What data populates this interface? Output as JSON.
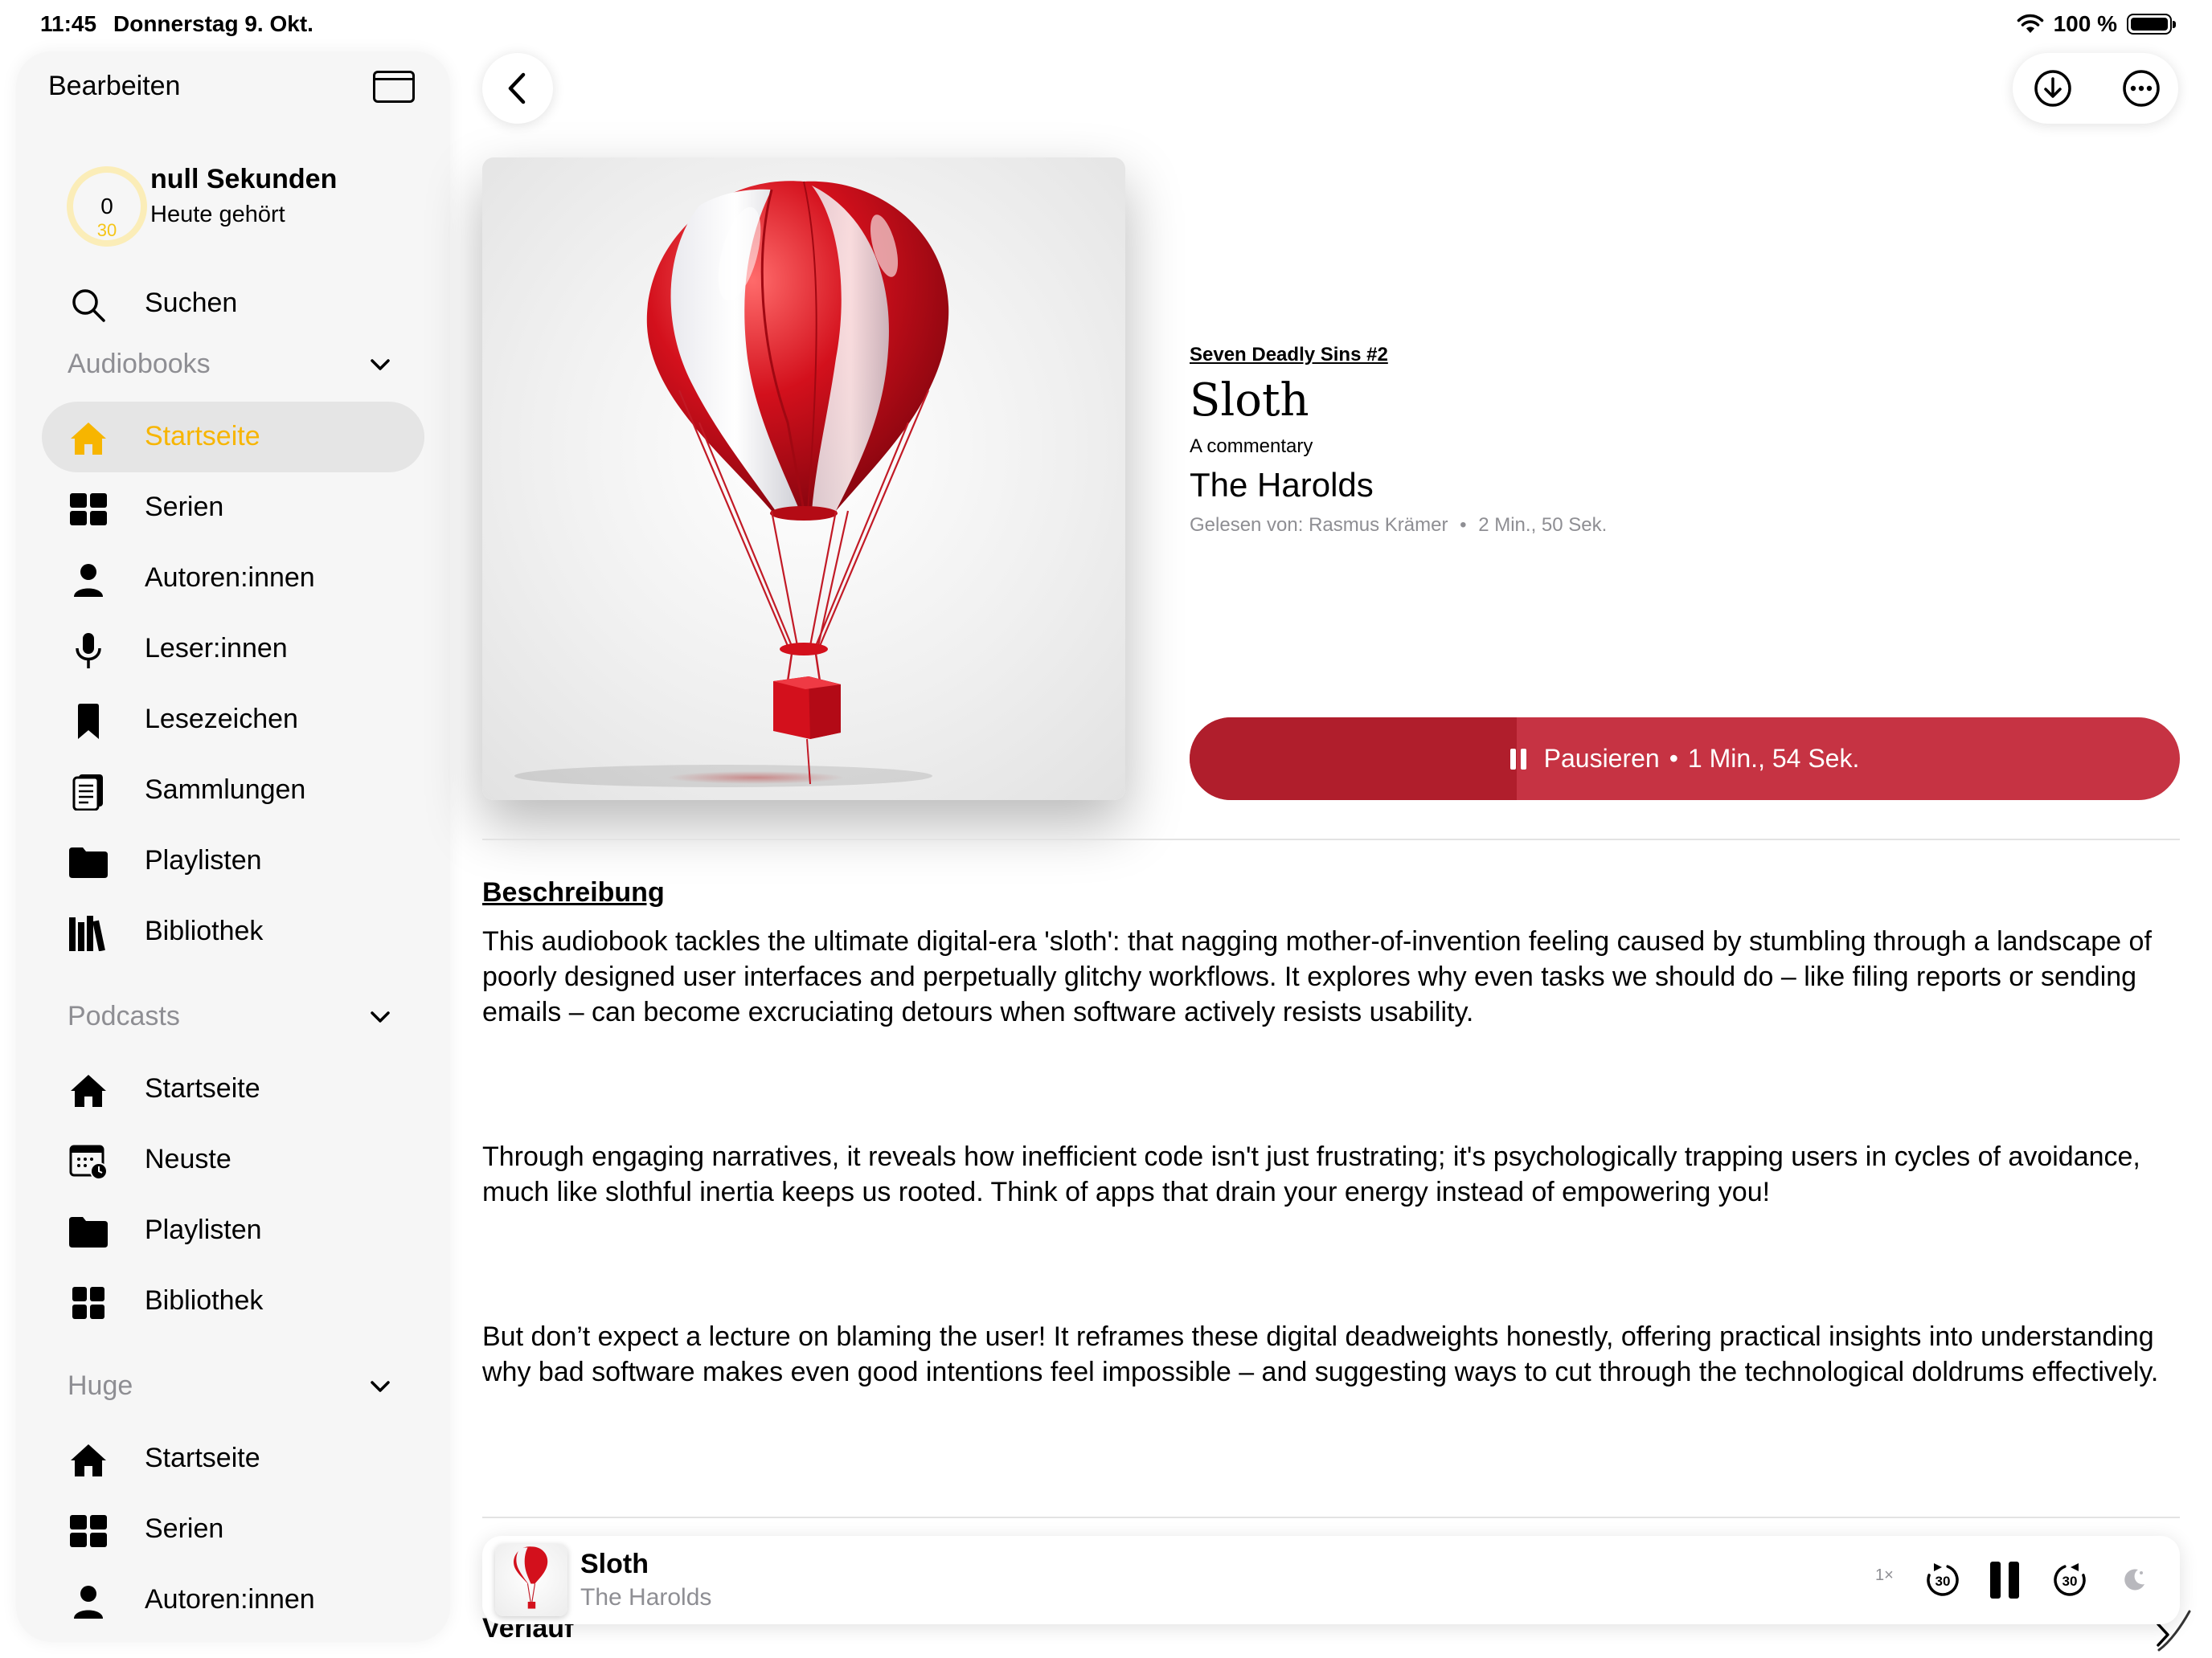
{
  "status_bar": {
    "time": "11:45",
    "date": "Donnerstag 9. Okt.",
    "battery": "100 %"
  },
  "sidebar": {
    "edit_label": "Bearbeiten",
    "goal": {
      "value": "0",
      "target": "30",
      "title": "null Sekunden",
      "subtitle": "Heute gehört"
    },
    "search_label": "Suchen",
    "sections": [
      {
        "title": "Audiobooks",
        "items": [
          {
            "label": "Startseite",
            "icon": "house-icon"
          },
          {
            "label": "Serien",
            "icon": "grid-icon"
          },
          {
            "label": "Autoren:innen",
            "icon": "person-icon"
          },
          {
            "label": "Leser:innen",
            "icon": "microphone-icon"
          },
          {
            "label": "Lesezeichen",
            "icon": "bookmark-icon"
          },
          {
            "label": "Sammlungen",
            "icon": "document-icon"
          },
          {
            "label": "Playlisten",
            "icon": "folder-icon"
          },
          {
            "label": "Bibliothek",
            "icon": "books-icon"
          }
        ]
      },
      {
        "title": "Podcasts",
        "items": [
          {
            "label": "Startseite",
            "icon": "house-icon"
          },
          {
            "label": "Neuste",
            "icon": "calendar-clock-icon"
          },
          {
            "label": "Playlisten",
            "icon": "folder-icon"
          },
          {
            "label": "Bibliothek",
            "icon": "grid-icon"
          }
        ]
      },
      {
        "title": "Huge",
        "items": [
          {
            "label": "Startseite",
            "icon": "house-icon"
          },
          {
            "label": "Serien",
            "icon": "grid-icon"
          },
          {
            "label": "Autoren:innen",
            "icon": "person-icon"
          }
        ]
      }
    ]
  },
  "book": {
    "series": "Seven Deadly Sins #2",
    "title": "Sloth",
    "subtitle": "A commentary",
    "author": "The Harolds",
    "narrator_label": "Gelesen von: Rasmus Krämer",
    "duration": "2 Min., 50 Sek.",
    "separator": "•",
    "progress_fraction": 0.33,
    "play_button": {
      "action": "Pausieren",
      "separator": "•",
      "remaining": "1 Min., 54 Sek."
    },
    "accent_color": "#c63343"
  },
  "description": {
    "heading": "Beschreibung",
    "paragraphs": [
      "This audiobook tackles the ultimate digital-era 'sloth': that nagging mother-of-invention feeling caused by stumbling through a landscape of poorly designed user interfaces and perpetually glitchy workflows. It explores why even tasks we should do – like filing reports or sending emails – can become excruciating detours when software actively resists usability.",
      "Through engaging narratives, it reveals how inefficient code isn't just frustrating; it's psychologically trapping users in cycles of avoidance, much like slothful inertia keeps us rooted. Think of apps that drain your energy instead of empowering you!",
      "But don’t expect a lecture on blaming the user! It reframes these digital deadweights honestly, offering practical insights into understanding why bad software makes even good intentions feel impossible – and suggesting ways to cut through the technological doldrums effectively."
    ]
  },
  "history_label": "Verlauf",
  "mini_player": {
    "title": "Sloth",
    "author": "The Harolds",
    "speed": "1×",
    "skip_back": "30",
    "skip_forward": "30"
  }
}
